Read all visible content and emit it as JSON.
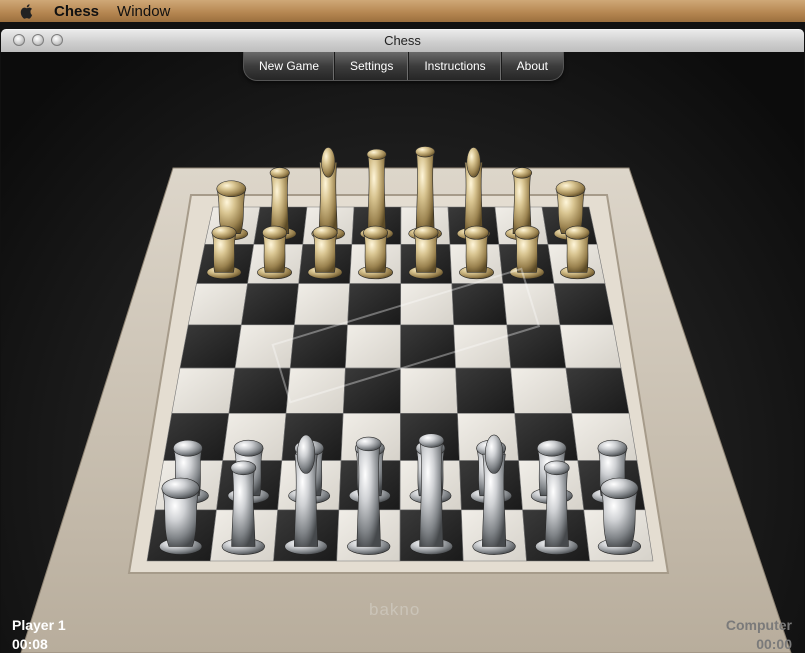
{
  "menubar": {
    "app_name": "Chess",
    "items": [
      "Window"
    ]
  },
  "window": {
    "title": "Chess"
  },
  "toolbar": {
    "buttons": [
      "New Game",
      "Settings",
      "Instructions",
      "About"
    ]
  },
  "players": {
    "human": {
      "name": "Player 1",
      "time": "00:08"
    },
    "computer": {
      "name": "Computer",
      "time": "00:00"
    }
  },
  "brand_text": "bakno",
  "board": {
    "rows": [
      [
        "R",
        "N",
        "B",
        "Q",
        "K",
        "B",
        "N",
        "R"
      ],
      [
        "P",
        "P",
        "P",
        "P",
        "P",
        "P",
        "P",
        "P"
      ],
      [
        "",
        "",
        "",
        "",
        "",
        "",
        "",
        ""
      ],
      [
        "",
        "",
        "",
        "",
        "",
        "",
        "",
        ""
      ],
      [
        "",
        "",
        "",
        "",
        "",
        "",
        "",
        ""
      ],
      [
        "",
        "",
        "",
        "",
        "",
        "",
        "",
        ""
      ],
      [
        "p",
        "p",
        "p",
        "p",
        "p",
        "p",
        "p",
        "p"
      ],
      [
        "r",
        "n",
        "b",
        "q",
        "k",
        "b",
        "n",
        "r"
      ]
    ],
    "gold_side": "top",
    "silver_side": "bottom"
  },
  "colors": {
    "gold_piece": "#c9b27a",
    "silver_piece": "#b9bcc0",
    "light_square": "#e9e6e0",
    "dark_square": "#2a2a2a",
    "frame": "#d7d0c4"
  }
}
